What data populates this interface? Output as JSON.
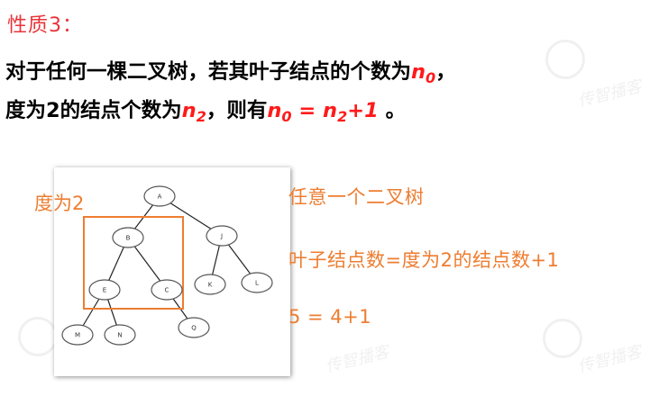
{
  "heading": {
    "prefix": "性质",
    "number": "3",
    "colon": "："
  },
  "statement": {
    "line1_text": "对于任何一棵二叉树，若其叶子结点的个数为",
    "line1_end": "，",
    "line2_text": "度为2的结点个数为",
    "line2_mid": "，则有",
    "line2_end": " 。",
    "n0_base": "n",
    "n0_sub": "0",
    "n2_base": "n",
    "n2_sub": "2",
    "formula_n0_base": "n",
    "formula_n0_sub": "0",
    "formula_eq": " = ",
    "formula_n2_base": "n",
    "formula_n2_sub": "2",
    "formula_plus": "+1"
  },
  "figure": {
    "degree_label": "度为2",
    "nodes": [
      "A",
      "B",
      "J",
      "E",
      "C",
      "K",
      "L",
      "M",
      "N",
      "Q"
    ]
  },
  "notes": {
    "line1": "任意一个二叉树",
    "line2": "叶子结点数=度为2的结点数+1",
    "line3": "5 = 4+1"
  },
  "colors": {
    "heading": "#e8343a",
    "formula": "#ff1a1a",
    "annotation": "#ed7d31"
  }
}
